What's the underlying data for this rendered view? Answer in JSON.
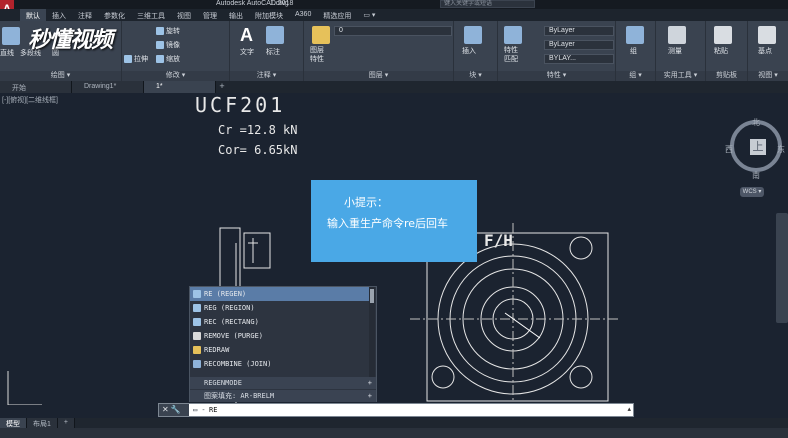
{
  "app": {
    "logo": "A",
    "title": "Autodesk AutoCAD 2018",
    "file": "1.dwg",
    "search_placeholder": "键入关键字或短语"
  },
  "watermark": "秒懂视频",
  "ribbon_tabs": [
    "默认",
    "插入",
    "注释",
    "参数化",
    "三维工具",
    "视图",
    "管理",
    "输出",
    "附加模块",
    "A360",
    "精选应用",
    "▭ ▾"
  ],
  "ribbon": {
    "groups": [
      {
        "label": "绘图 ▾"
      },
      {
        "label": "修改 ▾"
      },
      {
        "label": "注释 ▾"
      },
      {
        "label": "图层 ▾"
      },
      {
        "label": "块 ▾"
      },
      {
        "label": "特性 ▾"
      },
      {
        "label": "组 ▾"
      },
      {
        "label": "实用工具 ▾"
      },
      {
        "label": "剪贴板"
      },
      {
        "label": "视图 ▾"
      }
    ],
    "buttons": {
      "line": "直线",
      "polyline": "多段线",
      "circle": "圆",
      "rotate": "旋转",
      "mirror": "镜像",
      "stretch": "拉伸",
      "scale": "缩放",
      "text": "文字",
      "dimension": "标注",
      "layer_props": "图层特性",
      "insert": "插入",
      "match_props": "特性匹配",
      "group": "组",
      "measure": "测量",
      "paste": "粘贴",
      "base": "基点"
    },
    "layer_value": "0",
    "bylayer_1": "ByLayer",
    "bylayer_2": "ByLayer",
    "bylayer_3": "BYLAY..."
  },
  "file_tabs": [
    "开始",
    "Drawing1*",
    "1*"
  ],
  "viewport_label": "[-][俯视][二维线框]",
  "drawing": {
    "title": "UCF201",
    "line1": "Cr =12.8 kN",
    "line2": "Cor= 6.65kN",
    "part_label": "F∕H"
  },
  "tip": {
    "title": "小提示：",
    "body": "输入重生产命令re后回车"
  },
  "autocomplete": {
    "items": [
      "RE (REGEN)",
      "REG (REGION)",
      "REC (RECTANG)",
      "REMOVE (PURGE)",
      "REDRAW",
      "RECOMBINE (JOIN)"
    ],
    "sections": [
      "REGENMODE",
      "图案填充: AR-BRELM"
    ],
    "section_toggle": "+"
  },
  "command": {
    "icons": "✕ 🔧",
    "prompt": "▭ -",
    "input": "RE",
    "dropdown": "▴"
  },
  "layout_tabs": [
    "模型",
    "布局1",
    "+"
  ],
  "viewcube": {
    "north": "北",
    "south": "南",
    "west": "西",
    "east": "东",
    "face": "上",
    "wcs": "WCS ▾"
  },
  "colors": {
    "tip_bg": "#4aa8e6",
    "accent_red": "#b3232c"
  }
}
